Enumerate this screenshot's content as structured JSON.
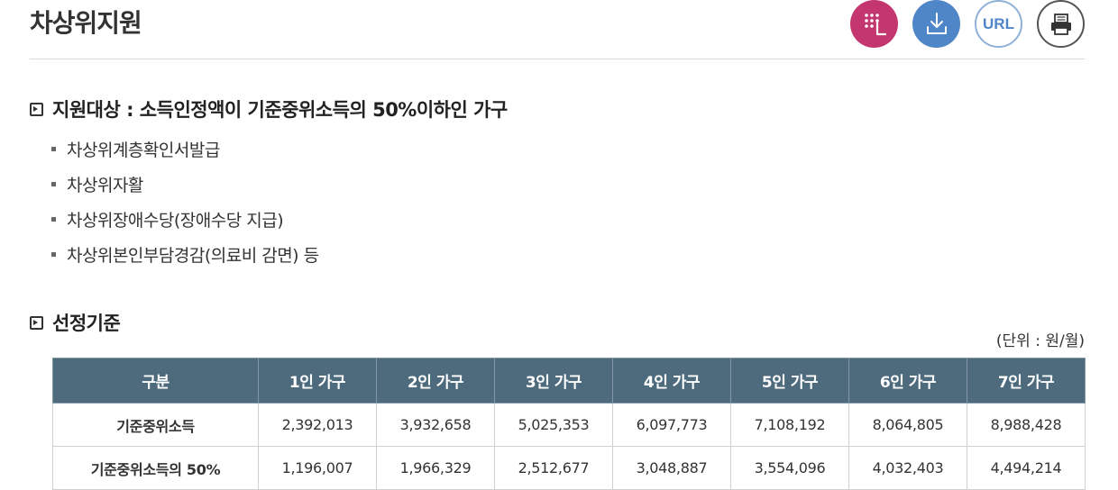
{
  "header": {
    "title": "차상위지원",
    "url_label": "URL"
  },
  "section_target": {
    "title": "지원대상 : 소득인정액이 기준중위소득의 50%이하인 가구",
    "items": [
      "차상위계층확인서발급",
      "차상위자활",
      "차상위장애수당(장애수당 지급)",
      "차상위본인부담경감(의료비 감면) 등"
    ]
  },
  "section_criteria": {
    "title": "선정기준",
    "unit": "(단위 : 원/월)",
    "columns": [
      "구분",
      "1인 가구",
      "2인 가구",
      "3인 가구",
      "4인 가구",
      "5인 가구",
      "6인 가구",
      "7인 가구"
    ],
    "rows": [
      {
        "label": "기준중위소득",
        "values": [
          "2,392,013",
          "3,932,658",
          "5,025,353",
          "6,097,773",
          "7,108,192",
          "8,064,805",
          "8,988,428"
        ]
      },
      {
        "label": "기준중위소득의 50%",
        "values": [
          "1,196,007",
          "1,966,329",
          "2,512,677",
          "3,048,887",
          "3,554,096",
          "4,032,403",
          "4,494,214"
        ]
      }
    ]
  },
  "colors": {
    "sign_language_button": "#c4366f",
    "download_button": "#4f86c8",
    "table_header": "#4e6b7d"
  },
  "icons": [
    "sign-language-icon",
    "download-icon",
    "url-icon",
    "print-icon"
  ]
}
